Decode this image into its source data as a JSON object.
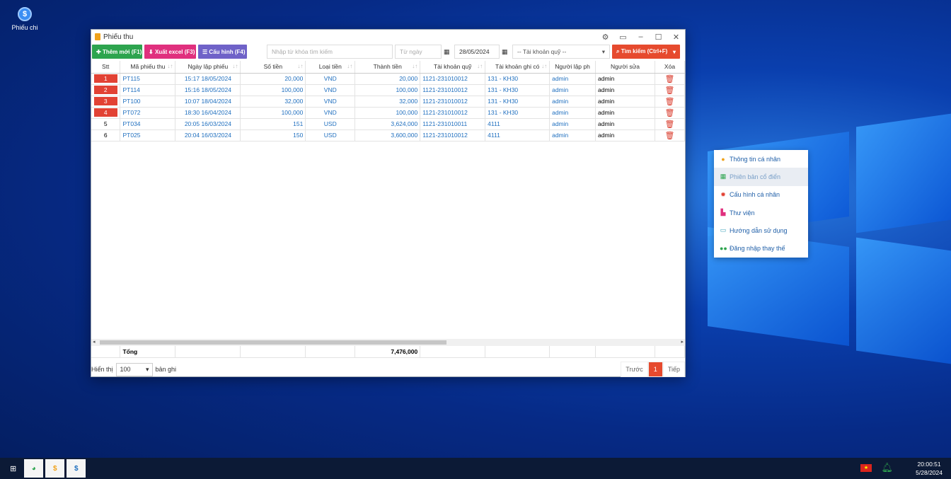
{
  "desktop": {
    "icon_label": "Phiếu chi"
  },
  "window": {
    "title": "Phiếu thu"
  },
  "toolbar": {
    "add_label": "Thêm mới (F1)",
    "export_label": "Xuất excel (F3)",
    "config_label": "Cấu hình (F4)",
    "search_placeholder": "Nhập từ khóa tìm kiếm",
    "from_date_placeholder": "Từ ngày",
    "to_date": "28/05/2024",
    "account_select": "-- Tài khoản quỹ --",
    "search_label": "Tìm kiếm (Ctrl+F)"
  },
  "table": {
    "headers": [
      "Stt",
      "Mã phiếu thu",
      "Ngày lập phiếu",
      "Số tiền",
      "Loại tiền",
      "Thành tiền",
      "Tài khoản quỹ",
      "Tài khoản ghi có",
      "Người lập ph",
      "Người sửa",
      "Xóa"
    ],
    "rows": [
      {
        "stt": "1",
        "code": "PT115",
        "date": "15:17 18/05/2024",
        "amount": "20,000",
        "currency": "VND",
        "total": "20,000",
        "fund": "1121-231010012",
        "credit": "131 - KH30",
        "creator": "admin",
        "editor": "admin"
      },
      {
        "stt": "2",
        "code": "PT114",
        "date": "15:16 18/05/2024",
        "amount": "100,000",
        "currency": "VND",
        "total": "100,000",
        "fund": "1121-231010012",
        "credit": "131 - KH30",
        "creator": "admin",
        "editor": "admin"
      },
      {
        "stt": "3",
        "code": "PT100",
        "date": "10:07 18/04/2024",
        "amount": "32,000",
        "currency": "VND",
        "total": "32,000",
        "fund": "1121-231010012",
        "credit": "131 - KH30",
        "creator": "admin",
        "editor": "admin"
      },
      {
        "stt": "4",
        "code": "PT072",
        "date": "18:30 16/04/2024",
        "amount": "100,000",
        "currency": "VND",
        "total": "100,000",
        "fund": "1121-231010012",
        "credit": "131 - KH30",
        "creator": "admin",
        "editor": "admin"
      },
      {
        "stt": "5",
        "code": "PT034",
        "date": "20:05 16/03/2024",
        "amount": "151",
        "currency": "USD",
        "total": "3,624,000",
        "fund": "1121-231010011",
        "credit": "4111",
        "creator": "admin",
        "editor": "admin"
      },
      {
        "stt": "6",
        "code": "PT025",
        "date": "20:04 16/03/2024",
        "amount": "150",
        "currency": "USD",
        "total": "3,600,000",
        "fund": "1121-231010012",
        "credit": "4111",
        "creator": "admin",
        "editor": "admin"
      }
    ],
    "footer_label": "Tổng",
    "footer_total": "7,476,000"
  },
  "pager": {
    "show_label": "Hiển thị",
    "page_size": "100",
    "records_label": "bản ghi",
    "prev": "Trước",
    "current": "1",
    "next": "Tiếp"
  },
  "menu": {
    "items": [
      "Thông tin cá nhân",
      "Phiên bản cổ điển",
      "Cấu hình cá nhân",
      "Thư viện",
      "Hướng dẫn sử dụng",
      "Đăng nhập thay thế"
    ]
  },
  "taskbar": {
    "time": "20:00:51",
    "date": "5/28/2024"
  },
  "colors": {
    "accent_red": "#e64a2e",
    "green": "#2da44e",
    "pink": "#e0307e",
    "purple": "#6f62c8",
    "link": "#1f6fbf"
  }
}
